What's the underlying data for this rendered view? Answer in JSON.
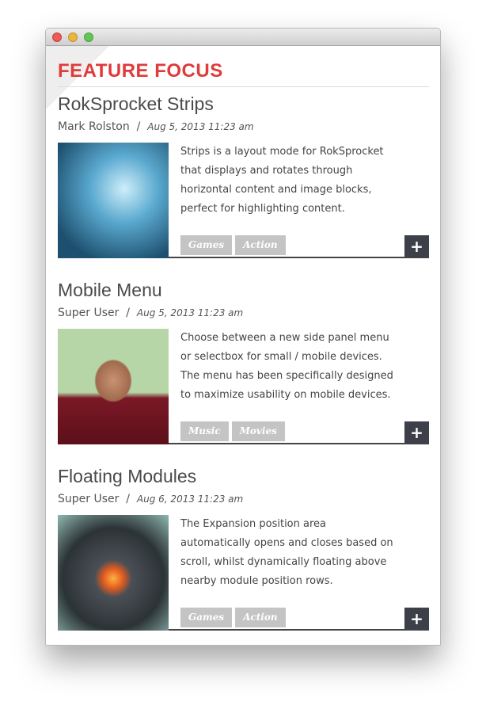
{
  "window": {
    "title": ""
  },
  "module": {
    "title": "FEATURE FOCUS"
  },
  "items": [
    {
      "title": "RokSprocket Strips",
      "author": "Mark Rolston",
      "separator": "/",
      "date": "Aug 5, 2013 11:23 am",
      "description": "Strips is a layout mode for RokSprocket that displays and rotates through horizontal content and image blocks, perfect for highlighting content.",
      "tags": [
        "Games",
        "Action"
      ],
      "more": "+",
      "image_colors": [
        "#2a6d8c",
        "#9fd3e8"
      ]
    },
    {
      "title": "Mobile Menu",
      "author": "Super User",
      "separator": "/",
      "date": "Aug 5, 2013 11:23 am",
      "description": "Choose between a new side panel menu or selectbox for small / mobile devices. The menu has been specifically designed to maximize usability on mobile devices.",
      "tags": [
        "Music",
        "Movies"
      ],
      "more": "+",
      "image_colors": [
        "#a8c9a0",
        "#7a1a24"
      ]
    },
    {
      "title": "Floating Modules",
      "author": "Super User",
      "separator": "/",
      "date": "Aug 6, 2013 11:23 am",
      "description": "The Expansion position area automatically opens and closes based on scroll, whilst dynamically floating above nearby module position rows.",
      "tags": [
        "Games",
        "Action"
      ],
      "more": "+",
      "image_colors": [
        "#3c4a4e",
        "#e05a20"
      ]
    }
  ]
}
